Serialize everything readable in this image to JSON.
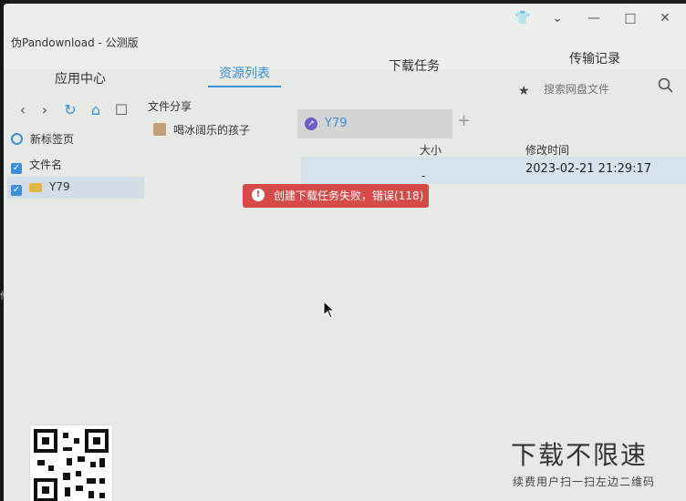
{
  "app_title": "伪Pandownload - 公测版",
  "window_controls": [
    "shirt-icon",
    "chevron-down-icon",
    "minimize-icon",
    "maximize-icon",
    "close-icon"
  ],
  "nav": {
    "tabs": [
      {
        "label": "应用中心"
      },
      {
        "label": "资源列表"
      },
      {
        "label": "下载任务"
      },
      {
        "label": "传输记录"
      }
    ],
    "active": "资源列表"
  },
  "toolbar": {
    "share_label": "文件分享",
    "icons": [
      "chevron-left-icon",
      "chevron-right-icon",
      "refresh-icon",
      "home-icon",
      "new-folder-icon"
    ]
  },
  "search": {
    "placeholder": "搜索网盘文件"
  },
  "sidebar": {
    "items": [
      {
        "label": "新标签页",
        "icon": "circle-icon"
      },
      {
        "label": "文件名",
        "icon": "checkbox-icon"
      },
      {
        "label": "Y79",
        "icon": "folder-icon"
      }
    ]
  },
  "file_share": {
    "item": "喝冰阔乐的孩子"
  },
  "path_tab": {
    "label": "Y79"
  },
  "table": {
    "headers": {
      "size": "大小",
      "modified": "修改时间"
    },
    "row": {
      "size": "-",
      "modified": "2023-02-21 21:29:17"
    }
  },
  "error_toast": {
    "message": "创建下载任务失败，错误(118)"
  },
  "promo": {
    "title": "下载不限速",
    "subtitle": "续费用户扫一扫左边二维码"
  },
  "left_snippet": "件"
}
